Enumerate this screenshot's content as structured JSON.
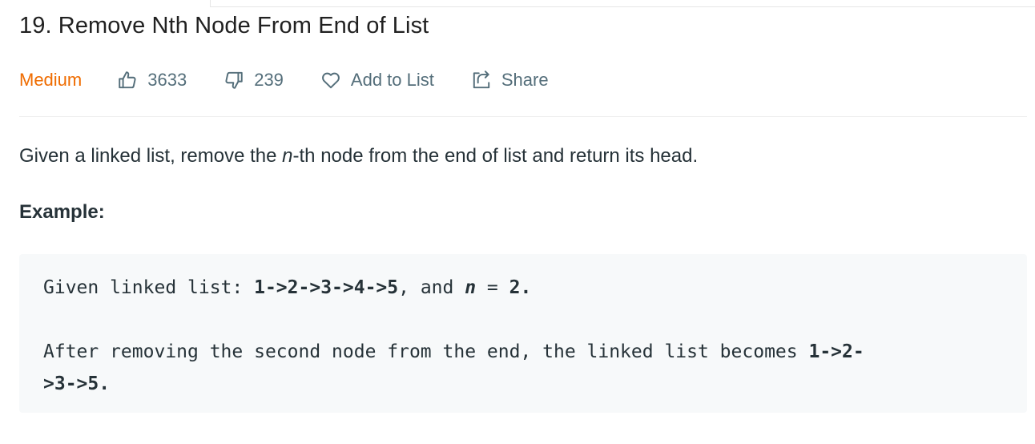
{
  "problem": {
    "title": "19. Remove Nth Node From End of List",
    "difficulty": "Medium",
    "likes": "3633",
    "dislikes": "239",
    "add_to_list_label": "Add to List",
    "share_label": "Share"
  },
  "description": {
    "prefix": "Given a linked list, remove the ",
    "variable": "n",
    "suffix": "-th node from the end of list and return its head."
  },
  "example": {
    "heading": "Example:",
    "line1_prefix": "Given linked list: ",
    "line1_list": "1->2->3->4->5",
    "line1_mid": ", and ",
    "line1_var": "n",
    "line1_eq": " = ",
    "line1_value": "2.",
    "line2_prefix": "After removing the second node from the end, the linked list becomes ",
    "line2_result_part1": "1->2-",
    "line2_result_part2": ">3->5."
  },
  "colors": {
    "difficulty_medium": "#ef6c00",
    "meta_text": "#546e7a",
    "code_background": "#f7f9fa"
  },
  "icons": {
    "likes": "thumbs-up-icon",
    "dislikes": "thumbs-down-icon",
    "add_to_list": "heart-icon",
    "share": "share-icon"
  }
}
